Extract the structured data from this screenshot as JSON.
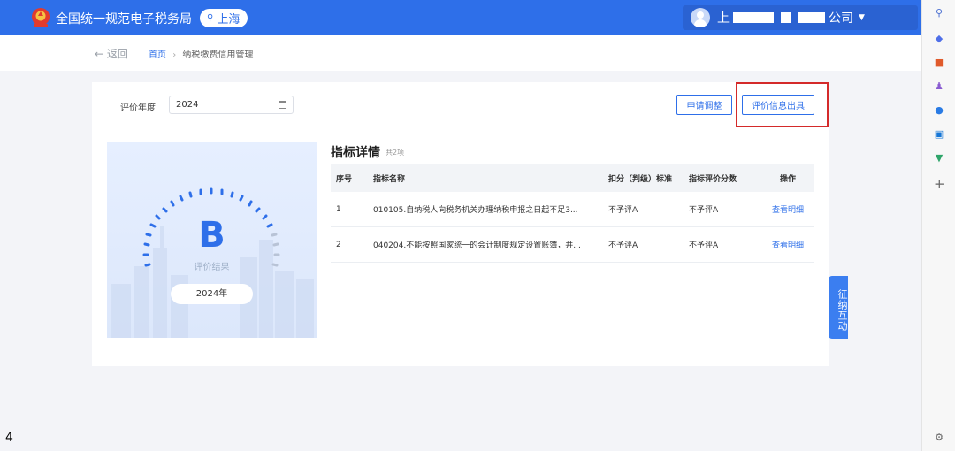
{
  "header": {
    "site_title": "全国统一规范电子税务局",
    "region": "上海",
    "user_name_start": "上",
    "user_name_end": "公司"
  },
  "breadcrumb": {
    "back_label": "返回",
    "home": "首页",
    "separator": "›",
    "current": "纳税缴费信用管理"
  },
  "filter": {
    "year_label": "评价年度",
    "year_value": "2024"
  },
  "actions": {
    "adjust_label": "申请调整",
    "issue_label": "评价信息出具"
  },
  "result": {
    "grade": "B",
    "caption": "评价结果",
    "year": "2024年"
  },
  "table": {
    "title": "指标详情",
    "count": "共2项",
    "headers": [
      "序号",
      "指标名称",
      "扣分（判级）标准",
      "指标评价分数",
      "操作"
    ],
    "rows": [
      {
        "no": "1",
        "name": "010105.自纳税人向税务机关办理纳税申报之日起不足3...",
        "standard": "不予评A",
        "score": "不予评A",
        "action": "查看明细"
      },
      {
        "no": "2",
        "name": "040204.不能按照国家统一的会计制度规定设置账簿，并...",
        "standard": "不予评A",
        "score": "不予评A",
        "action": "查看明细"
      }
    ]
  },
  "float_tab": "征纳互动",
  "page_number": "4",
  "colors": {
    "brand": "#2e6fe9",
    "highlight": "#d42a2a"
  }
}
